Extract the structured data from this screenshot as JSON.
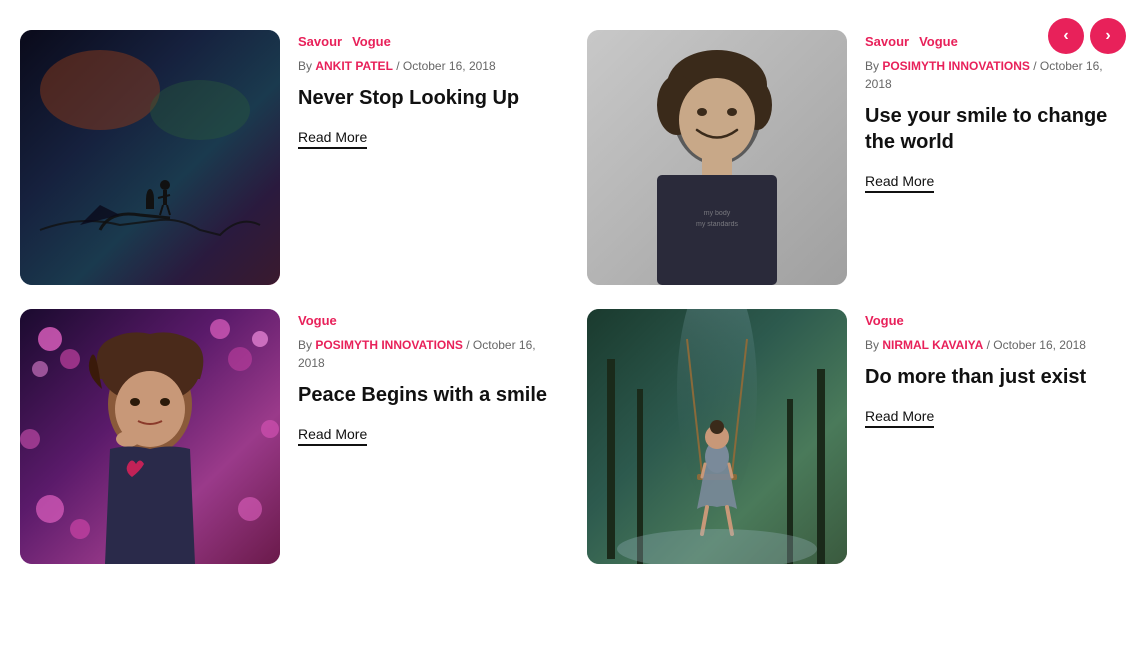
{
  "nav": {
    "prev_label": "‹",
    "next_label": "›"
  },
  "cards": [
    {
      "id": "card-1",
      "tags": [
        "Savour",
        "Vogue"
      ],
      "author": "ANKIT PATEL",
      "date": "October 16, 2018",
      "title": "Never Stop Looking Up",
      "read_more": "Read More",
      "img_style": "dark"
    },
    {
      "id": "card-2",
      "tags": [
        "Savour",
        "Vogue"
      ],
      "author": "POSIMYTH INNOVATIONS",
      "date": "October 16, 2018",
      "title": "Use your smile to change the world",
      "read_more": "Read More",
      "img_style": "smile"
    },
    {
      "id": "card-3",
      "tags": [
        "Vogue"
      ],
      "author": "POSIMYTH INNOVATIONS",
      "date": "October 16, 2018",
      "title": "Peace Begins with a smile",
      "read_more": "Read More",
      "img_style": "flowers"
    },
    {
      "id": "card-4",
      "tags": [
        "Vogue"
      ],
      "author": "NIRMAL KAVAIYA",
      "date": "October 16, 2018",
      "title": "Do more than just exist",
      "read_more": "Read More",
      "img_style": "swing"
    }
  ]
}
